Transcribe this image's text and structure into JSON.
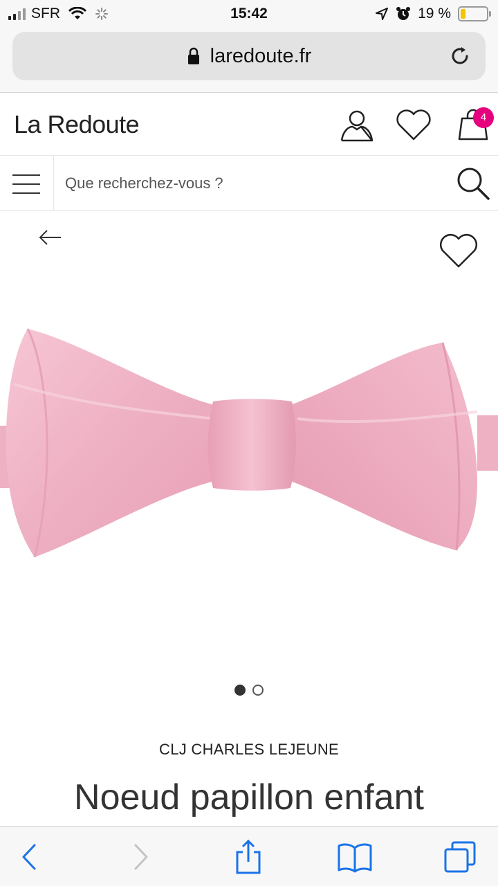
{
  "status_bar": {
    "carrier": "SFR",
    "time": "15:42",
    "battery_percent": "19 %",
    "battery_level": 0.19,
    "battery_color": "#f5c400"
  },
  "browser": {
    "url": "laredoute.fr",
    "icons": [
      "lock-icon",
      "reload-icon"
    ]
  },
  "site_header": {
    "logo": "La Redoute",
    "cart_count": "4",
    "badge_color": "#e6007e",
    "icons": [
      "account-icon",
      "wishlist-icon",
      "cart-icon"
    ]
  },
  "search": {
    "placeholder": "Que recherchez-vous ?"
  },
  "product": {
    "brand": "CLJ CHARLES LEJEUNE",
    "title": "Noeud papillon enfant",
    "image_count": 2,
    "active_image": 1,
    "bowtie_color": "#f2b6c8"
  },
  "toolbar": {
    "icons": [
      "back-icon",
      "forward-icon",
      "share-icon",
      "bookmarks-icon",
      "tabs-icon"
    ],
    "accent": "#1a73e8"
  }
}
